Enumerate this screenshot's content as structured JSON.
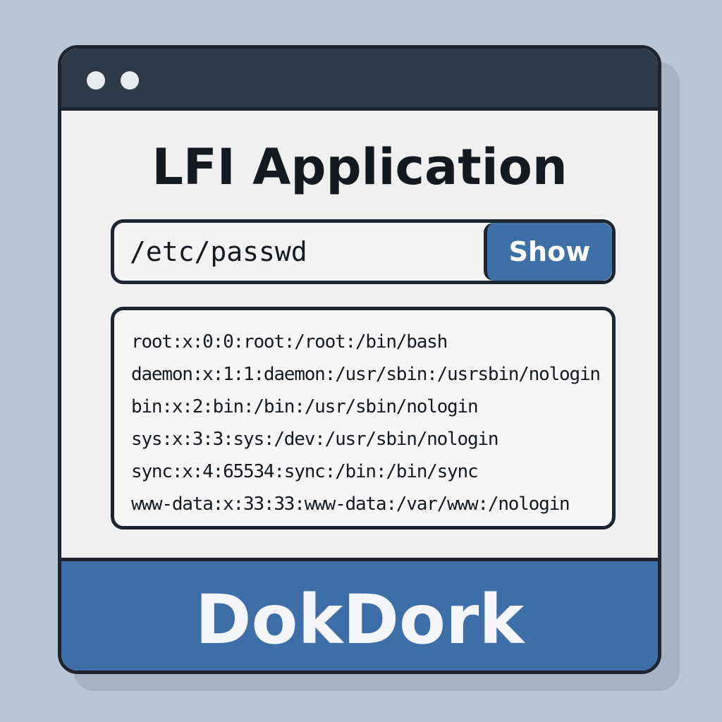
{
  "window": {
    "controls": [
      "window-dot",
      "window-dot"
    ]
  },
  "header": {
    "title": "LFI Application"
  },
  "search": {
    "value": "/etc/passwd",
    "button_label": "Show"
  },
  "output": {
    "lines": [
      "root:x:0:0:root:/root:/bin/bash",
      "daemon:x:1:1:daemon:/usr/sbin:/usrsbin/nologin",
      "bin:x:2:bin:/bin:/usr/sbin/nologin",
      "sys:x:3:3:sys:/dev:/usr/sbin/nologin",
      "sync:x:4:65534:sync:/bin:/bin/sync",
      "www-data:x:33:33:www-data:/var/www:/nologin"
    ]
  },
  "footer": {
    "brand": "DokDork"
  },
  "colors": {
    "accent": "#3e6fa6",
    "titlebar": "#2d3a4a",
    "background": "#b9c6d6"
  }
}
